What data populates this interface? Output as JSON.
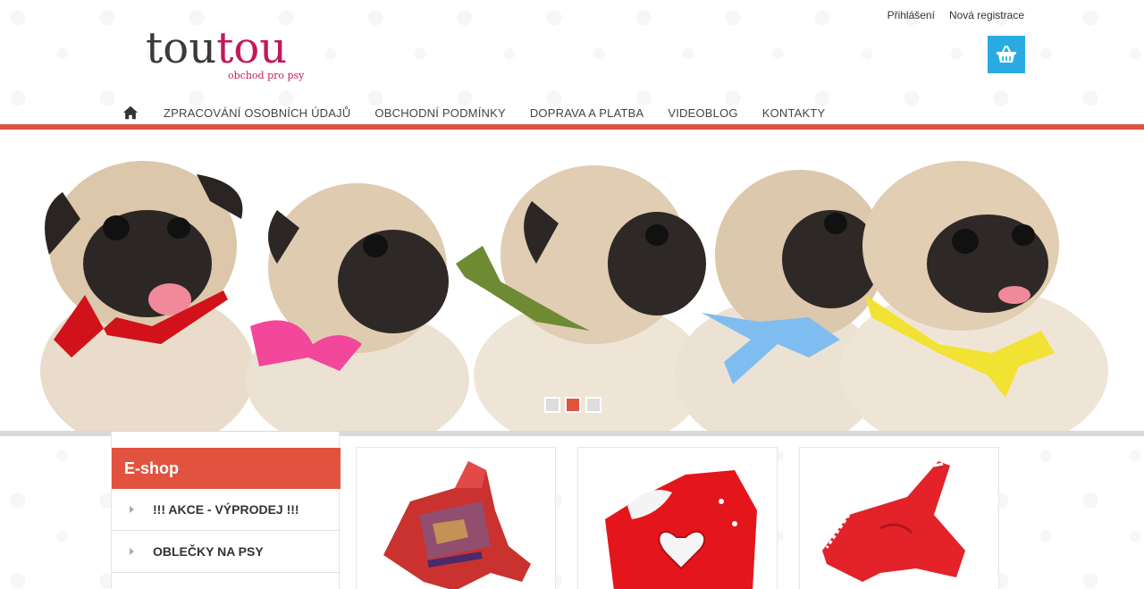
{
  "brand": {
    "logo_part1": "tou",
    "logo_part2": "tou",
    "tagline": "obchod pro psy",
    "color_dark": "#3a3a3a",
    "color_accent": "#c2185b"
  },
  "top_links": {
    "login": "Přihlášení",
    "register": "Nová registrace"
  },
  "cart": {
    "icon": "shopping-basket-icon",
    "color": "#29abe2"
  },
  "nav": {
    "home_icon": "home-icon",
    "items": [
      "ZPRACOVÁNÍ OSOBNÍCH ÚDAJŮ",
      "OBCHODNÍ PODMÍNKY",
      "DOPRAVA A PLATBA",
      "VIDEOBLOG",
      "KONTAKTY"
    ]
  },
  "theme": {
    "accent": "#e2533f"
  },
  "slider": {
    "slide_count": 3,
    "active_index": 1
  },
  "sidebar": {
    "title": "E-shop",
    "items": [
      "!!! AKCE - VÝPRODEJ !!!",
      "OBLEČKY NA PSY"
    ]
  },
  "products": [
    {
      "image": "red-patterned-dog-jacket"
    },
    {
      "image": "red-dog-jumpsuit-heart"
    },
    {
      "image": "red-striped-dog-tracksuit"
    }
  ]
}
